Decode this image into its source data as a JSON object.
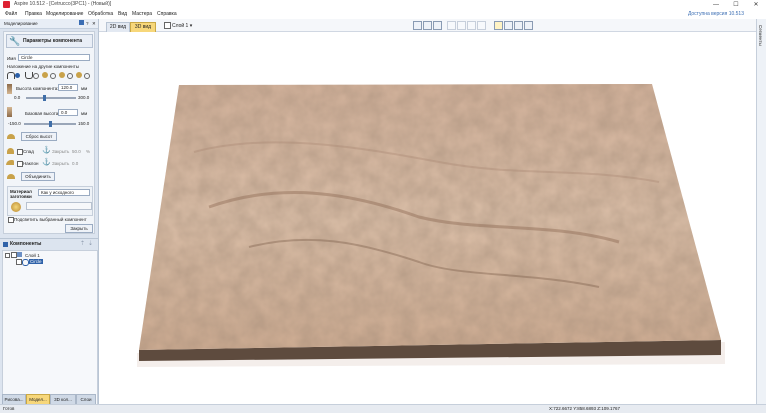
{
  "window": {
    "title": "Aspire 10.512 - [Cetrucco(3PC1) - (Новый)]",
    "min": "—",
    "max": "☐",
    "close": "✕"
  },
  "menu": [
    "Файл",
    "Правка",
    "Моделирование",
    "Обработка",
    "Вид",
    "Мастера",
    "Справка"
  ],
  "update_link": "Доступна версия 10.513",
  "left_panel": {
    "header": "Моделирование",
    "header_icons": {
      "help": "?",
      "close": "✕"
    },
    "section_title": "Параметры компонента",
    "name_label": "Имя",
    "name_value": "Circle",
    "overlay_label": "Наложение на другие компоненты",
    "height_label": "Высота компонента:",
    "height_value": "120.0",
    "height_unit": "мм",
    "height_min": "0.0",
    "height_max": "300.0",
    "base_label": "Базовая высота:",
    "base_value": "0.0",
    "base_unit": "мм",
    "base_min": "-150.0",
    "base_max": "150.0",
    "reset_button": "Сброс высот",
    "fade_label": "Спад",
    "fade_shift_label": "Закрыть",
    "fade_value": "50.0",
    "fade_unit": "%",
    "tilt_label": "Наклон",
    "tilt_shift_label": "Закрыть",
    "tilt_value": "0.0",
    "merge_button": "Объединить",
    "material_label": "Материал заготовки",
    "material_select": "Как у исходного",
    "highlight_label": "Подсветить выбранный компонент",
    "close_button": "Закрыть"
  },
  "components_panel": {
    "title": "Компоненты",
    "tree": [
      {
        "label": "Слой 1"
      },
      {
        "label": "Circle"
      }
    ]
  },
  "bottom_tabs": [
    "Рисова...",
    "Модел...",
    "3D кол...",
    "Слои"
  ],
  "view_tabs": {
    "tab2d": "2D вид",
    "tab3d": "3D вид"
  },
  "layer_dropdown": "Слой 1 ▾",
  "right_bar_label": "Сегменты",
  "status": {
    "left": "Готов",
    "coords": "X:722.6672 Y:858.6893 Z:109.1767"
  },
  "colors": {
    "panel_bg": "#dce4ef",
    "accent_tab": "#f7d77a",
    "terrain": "#d8b9a0",
    "base": "#5e4b3e",
    "link": "#3a6db3"
  }
}
